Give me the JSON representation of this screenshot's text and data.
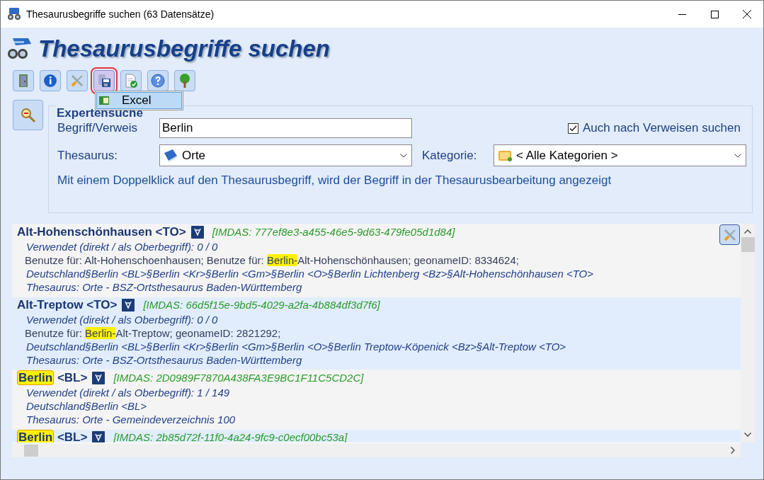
{
  "window": {
    "title": "Thesaurusbegriffe suchen (63 Datensätze)"
  },
  "header": {
    "title": "Thesaurusbegriffe suchen"
  },
  "toolbar": [
    {
      "selected": false
    },
    {
      "selected": false
    },
    {
      "selected": false
    },
    {
      "selected": true
    },
    {
      "selected": false
    },
    {
      "selected": false
    },
    {
      "selected": false
    }
  ],
  "export_menu": {
    "items": [
      "Excel"
    ]
  },
  "search": {
    "legend": "Expertensuche",
    "term_label": "Begriff/Verweis",
    "term_value": "Berlin",
    "include_refs": {
      "label": "Auch nach Verweisen suchen",
      "checked": true
    },
    "thesaurus_label": "Thesaurus:",
    "thesaurus_value": "Orte",
    "category_label": "Kategorie:",
    "category_value": "< Alle Kategorien >",
    "hint": "Mit einem Doppelklick auf den Thesaurusbegriff, wird der Begriff in der Thesaurusbearbeitung angezeigt"
  },
  "results": [
    {
      "title": [
        {
          "text": "Alt-Hohenschönhausen <TO>",
          "highlight": false
        }
      ],
      "imdas": "[IMDAS: 777ef8e3-a455-46e5-9d63-479fe05d1d84]",
      "lines": [
        {
          "kind": "italic",
          "parts": [
            {
              "text": "Verwendet (direkt / als Oberbegriff): 0 / 0",
              "highlight": false
            }
          ]
        },
        {
          "kind": "plain",
          "parts": [
            {
              "text": "Benutze für: Alt-Hohenschoenhausen; Benutze für: ",
              "highlight": false
            },
            {
              "text": "Berlin-",
              "highlight": true
            },
            {
              "text": "Alt-Hohenschönhausen; geonameID: 8334624;",
              "highlight": false
            }
          ]
        },
        {
          "kind": "italic",
          "parts": [
            {
              "text": "Deutschland§Berlin <BL>§Berlin <Kr>§Berlin <Gm>§Berlin <O>§Berlin Lichtenberg <Bz>§Alt-Hohenschönhausen <TO>",
              "highlight": false
            }
          ]
        },
        {
          "kind": "italic",
          "parts": [
            {
              "text": "Thesaurus: Orte - BSZ-Ortsthesaurus Baden-Württemberg",
              "highlight": false
            }
          ]
        }
      ]
    },
    {
      "title": [
        {
          "text": "Alt-Treptow <TO>",
          "highlight": false
        }
      ],
      "imdas": "[IMDAS: 66d5f15e-9bd5-4029-a2fa-4b884df3d7f6]",
      "lines": [
        {
          "kind": "italic",
          "parts": [
            {
              "text": "Verwendet (direkt / als Oberbegriff): 0 / 0",
              "highlight": false
            }
          ]
        },
        {
          "kind": "plain",
          "parts": [
            {
              "text": "Benutze für: ",
              "highlight": false
            },
            {
              "text": "Berlin-",
              "highlight": true
            },
            {
              "text": "Alt-Treptow; geonameID: 2821292;",
              "highlight": false
            }
          ]
        },
        {
          "kind": "italic",
          "parts": [
            {
              "text": "Deutschland§Berlin <BL>§Berlin <Kr>§Berlin <Gm>§Berlin <O>§Berlin Treptow-Köpenick <Bz>§Alt-Treptow <TO>",
              "highlight": false
            }
          ]
        },
        {
          "kind": "italic",
          "parts": [
            {
              "text": "Thesaurus: Orte - BSZ-Ortsthesaurus Baden-Württemberg",
              "highlight": false
            }
          ]
        }
      ]
    },
    {
      "title": [
        {
          "text": "Berlin",
          "highlight": true
        },
        {
          "text": " <BL>",
          "highlight": false
        }
      ],
      "imdas": "[IMDAS: 2D0989F7870A438FA3E9BC1F11C5CD2C]",
      "lines": [
        {
          "kind": "italic",
          "parts": [
            {
              "text": "Verwendet (direkt / als Oberbegriff): 1 / 149",
              "highlight": false
            }
          ]
        },
        {
          "kind": "italic",
          "parts": [
            {
              "text": "Deutschland§Berlin <BL>",
              "highlight": false
            }
          ]
        },
        {
          "kind": "italic",
          "parts": [
            {
              "text": "Thesaurus: Orte - Gemeindeverzeichnis 100",
              "highlight": false
            }
          ]
        }
      ]
    },
    {
      "title": [
        {
          "text": "Berlin",
          "highlight": true
        },
        {
          "text": " <BL>",
          "highlight": false
        }
      ],
      "imdas": "[IMDAS: 2b85d72f-11f0-4a24-9fc9-c0ecf00bc53a]"
    }
  ]
}
